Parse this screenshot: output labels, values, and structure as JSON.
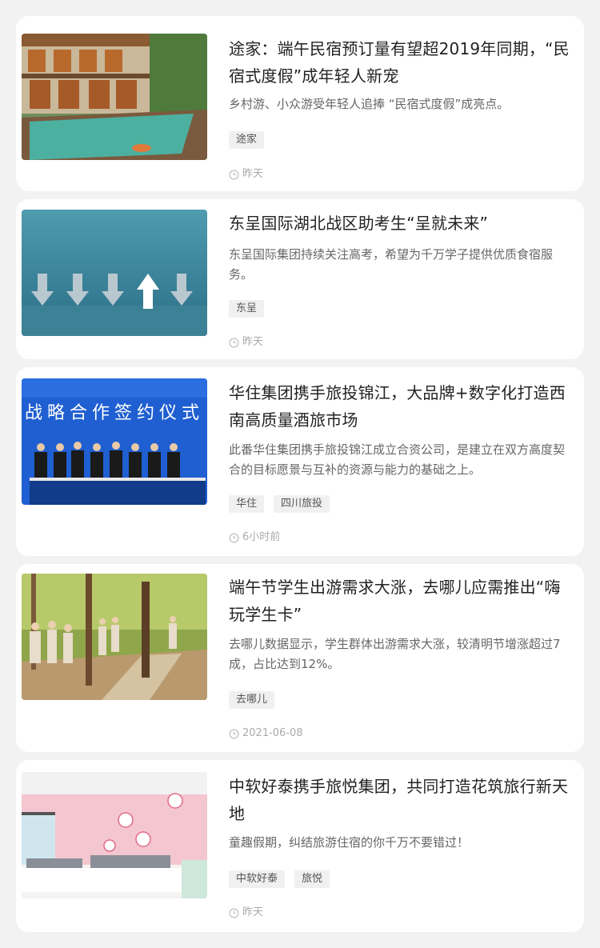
{
  "articles": [
    {
      "title": "途家：端午民宿预订量有望超2019年同期，“民宿式度假”成年轻人新宠",
      "description": "乡村游、小众游受年轻人追捧 “民宿式度假”成亮点。",
      "tags": [
        "途家"
      ],
      "time": "昨天"
    },
    {
      "title": "东呈国际湖北战区助考生“呈就未来”",
      "description": "东呈国际集团持续关注高考，希望为千万学子提供优质食宿服务。",
      "tags": [
        "东呈"
      ],
      "time": "昨天"
    },
    {
      "title": "华住集团携手旅投锦江，大品牌+数字化打造西南高质量酒旅市场",
      "description": "此番华住集团携手旅投锦江成立合资公司，是建立在双方高度契合的目标愿景与互补的资源与能力的基础之上。",
      "tags": [
        "华住",
        "四川旅投"
      ],
      "time": "6小时前",
      "image_text": "战略合作签约仪式"
    },
    {
      "title": "端午节学生出游需求大涨，去哪儿应需推出“嗨玩学生卡”",
      "description": "去哪儿数据显示，学生群体出游需求大涨，较清明节增涨超过7成，占比达到12%。",
      "tags": [
        "去哪儿"
      ],
      "time": "2021-06-08"
    },
    {
      "title": "中软好泰携手旅悦集团，共同打造花筑旅行新天地",
      "description": "童趣假期，纠结旅游住宿的你千万不要错过！",
      "tags": [
        "中软好泰",
        "旅悦"
      ],
      "time": "昨天"
    }
  ]
}
